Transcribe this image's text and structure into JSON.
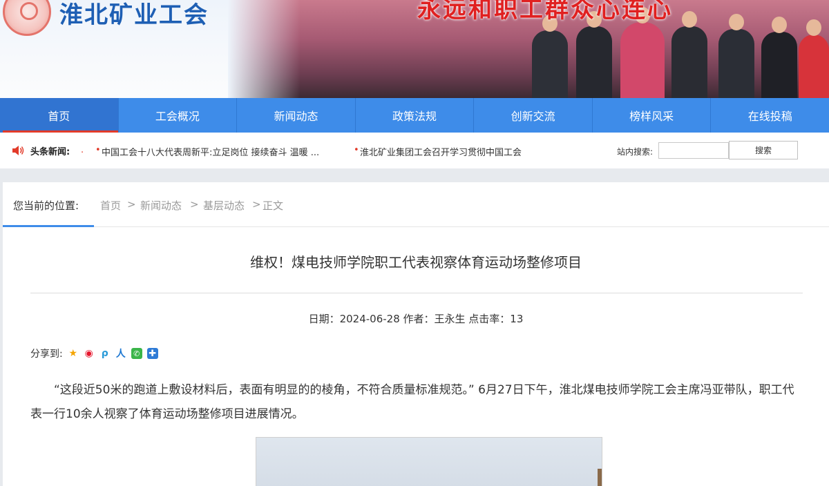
{
  "header": {
    "site_name": "淮北矿业工会",
    "slogan": "永远和职工群众心连心"
  },
  "nav": {
    "items": [
      "首页",
      "工会概况",
      "新闻动态",
      "政策法规",
      "创新交流",
      "榜样风采",
      "在线投稿"
    ],
    "active_index": 0
  },
  "headlines": {
    "label": "头条新闻:",
    "items": [
      "中国工会十八大代表周新平:立足岗位 接续奋斗 温暖 ...",
      "淮北矿业集团工会召开学习贯彻中国工会"
    ]
  },
  "search": {
    "label": "站内搜索:",
    "placeholder": "",
    "button": "搜索"
  },
  "breadcrumb": {
    "label": "您当前的位置:",
    "items": [
      "首页",
      "新闻动态",
      "基层动态",
      "正文"
    ],
    "separator": ">"
  },
  "article": {
    "title": "维权！煤电技师学院职工代表视察体育运动场整修项目",
    "meta": "日期：2024-06-28 作者：王永生 点击率：13",
    "share_label": "分享到:",
    "share_icons": [
      "qzone-icon",
      "weibo-icon",
      "pengyou-icon",
      "renren-icon",
      "wechat-icon",
      "more-share-icon"
    ],
    "paragraph": "“这段近50米的跑道上敷设材料后，表面有明显的的棱角，不符合质量标准规范。” 6月27日下午，淮北煤电技师学院工会主席冯亚带队，职工代表一行10余人视察了体育运动场整修项目进展情况。"
  },
  "colors": {
    "nav_blue": "#3e8ce9",
    "active_red": "#e23b2a",
    "title_blue": "#1e5fb4",
    "slogan_red": "#e02020"
  }
}
